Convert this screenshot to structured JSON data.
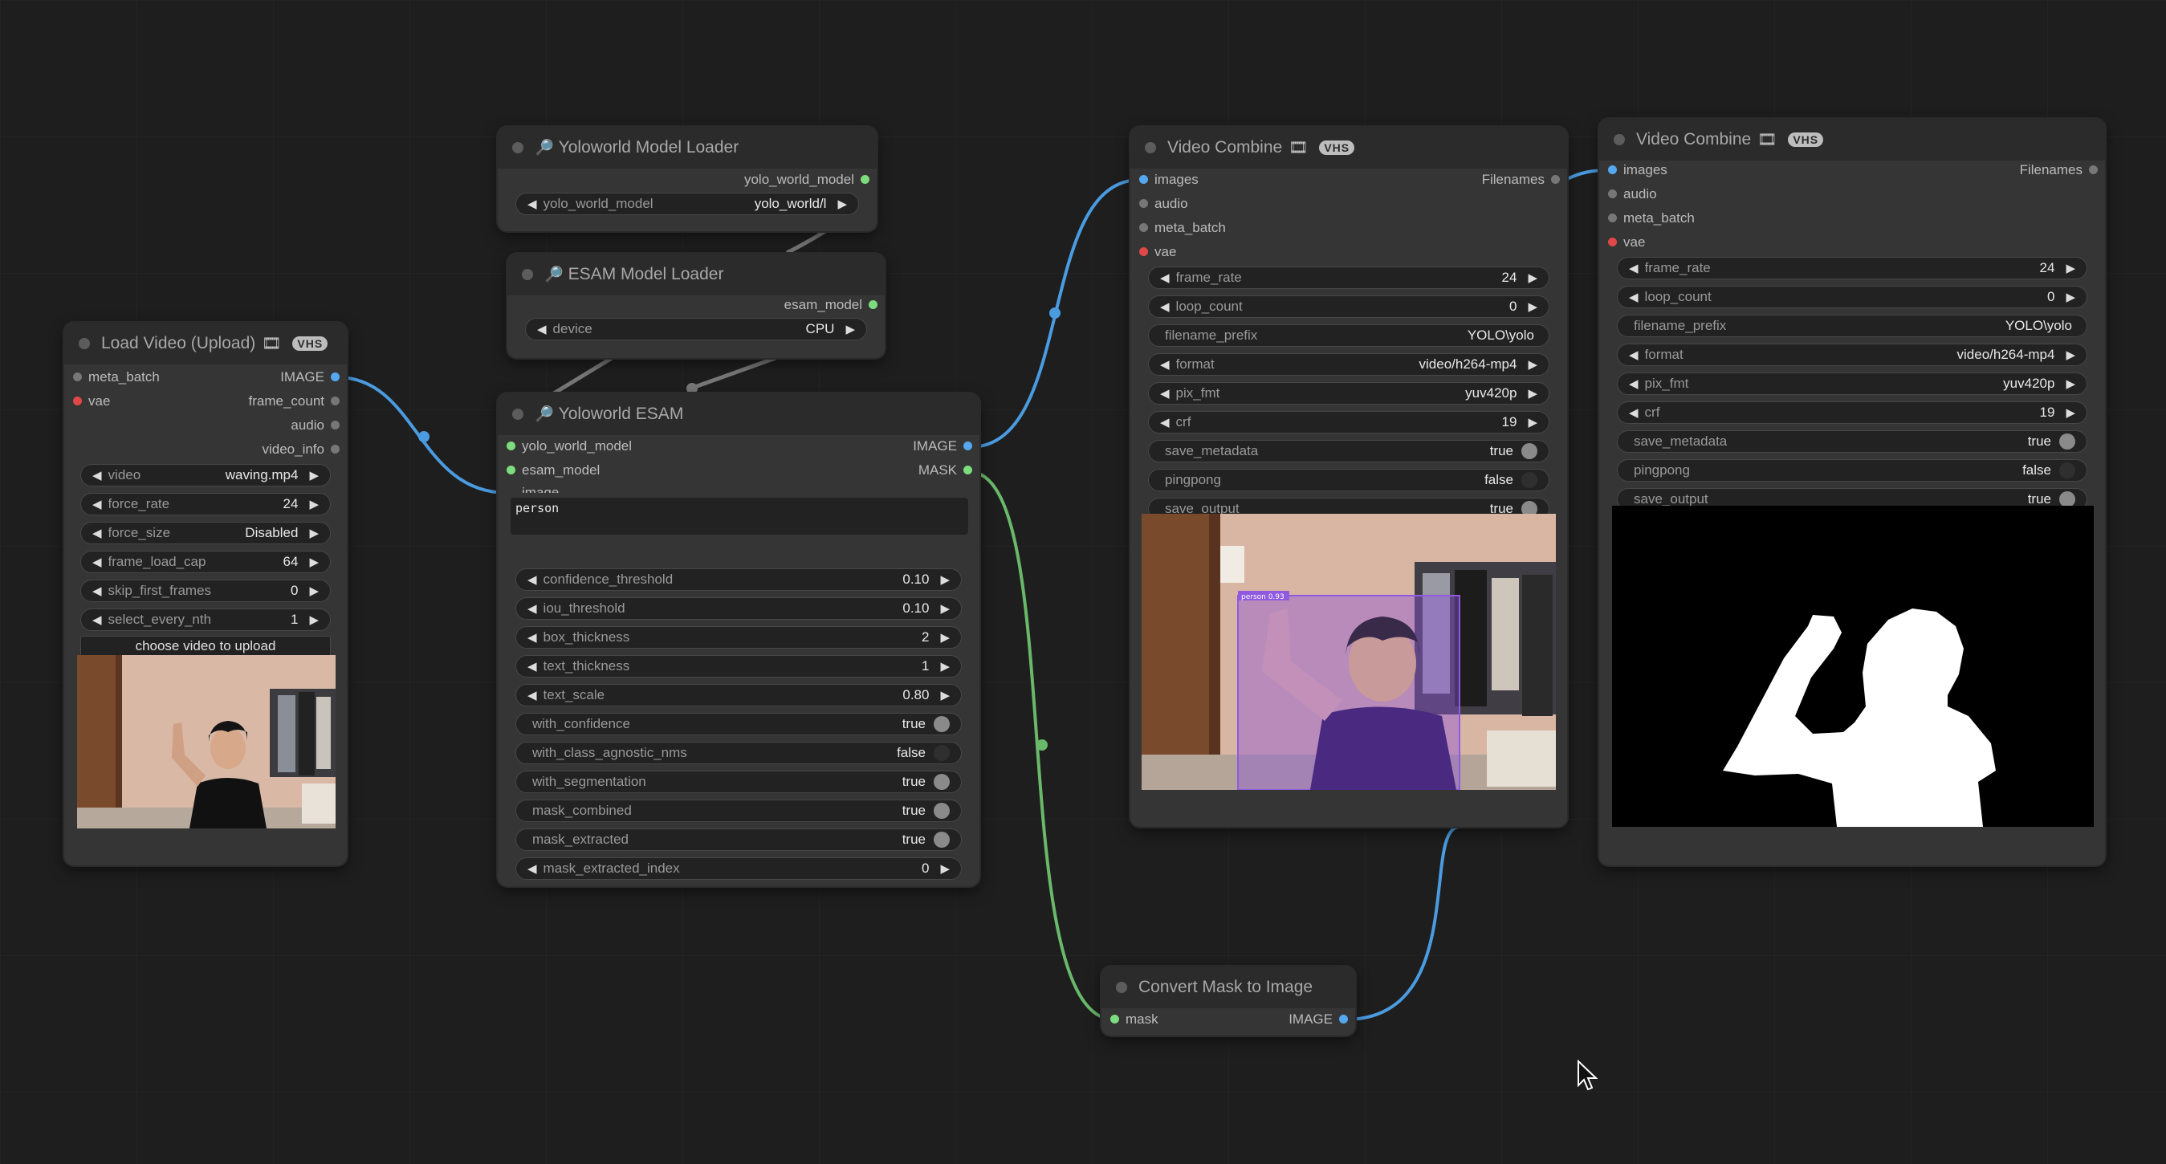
{
  "nodes": {
    "yolo_loader": {
      "title": "Yoloworld Model Loader",
      "output": "yolo_world_model",
      "widget": {
        "label": "yolo_world_model",
        "value": "yolo_world/l"
      }
    },
    "esam_loader": {
      "title": "ESAM Model Loader",
      "output": "esam_model",
      "widget": {
        "label": "device",
        "value": "CPU"
      }
    },
    "load_video": {
      "title": "Load Video (Upload)",
      "badge": "VHS",
      "inputs": [
        "meta_batch",
        "vae"
      ],
      "outputs": [
        "IMAGE",
        "frame_count",
        "audio",
        "video_info"
      ],
      "widgets": [
        {
          "label": "video",
          "value": "waving.mp4"
        },
        {
          "label": "force_rate",
          "value": "24"
        },
        {
          "label": "force_size",
          "value": "Disabled"
        },
        {
          "label": "frame_load_cap",
          "value": "64"
        },
        {
          "label": "skip_first_frames",
          "value": "0"
        },
        {
          "label": "select_every_nth",
          "value": "1"
        }
      ],
      "upload_label": "choose video to upload"
    },
    "esam": {
      "title": "Yoloworld ESAM",
      "inputs": [
        "yolo_world_model",
        "esam_model",
        "image"
      ],
      "outputs": [
        "IMAGE",
        "MASK"
      ],
      "categories": "person",
      "widgets": [
        {
          "label": "confidence_threshold",
          "value": "0.10",
          "kind": "num"
        },
        {
          "label": "iou_threshold",
          "value": "0.10",
          "kind": "num"
        },
        {
          "label": "box_thickness",
          "value": "2",
          "kind": "num"
        },
        {
          "label": "text_thickness",
          "value": "1",
          "kind": "num"
        },
        {
          "label": "text_scale",
          "value": "0.80",
          "kind": "num"
        },
        {
          "label": "with_confidence",
          "value": "true",
          "kind": "toggle"
        },
        {
          "label": "with_class_agnostic_nms",
          "value": "false",
          "kind": "toggle"
        },
        {
          "label": "with_segmentation",
          "value": "true",
          "kind": "toggle"
        },
        {
          "label": "mask_combined",
          "value": "true",
          "kind": "toggle"
        },
        {
          "label": "mask_extracted",
          "value": "true",
          "kind": "toggle"
        },
        {
          "label": "mask_extracted_index",
          "value": "0",
          "kind": "num"
        }
      ]
    },
    "combine1": {
      "title": "Video Combine",
      "badge": "VHS",
      "inputs": [
        "images",
        "audio",
        "meta_batch",
        "vae"
      ],
      "output": "Filenames",
      "widgets": [
        {
          "label": "frame_rate",
          "value": "24",
          "kind": "num"
        },
        {
          "label": "loop_count",
          "value": "0",
          "kind": "num"
        },
        {
          "label": "filename_prefix",
          "value": "YOLO\\yolo",
          "kind": "text"
        },
        {
          "label": "format",
          "value": "video/h264-mp4",
          "kind": "num"
        },
        {
          "label": "pix_fmt",
          "value": "yuv420p",
          "kind": "num"
        },
        {
          "label": "crf",
          "value": "19",
          "kind": "num"
        },
        {
          "label": "save_metadata",
          "value": "true",
          "kind": "toggle"
        },
        {
          "label": "pingpong",
          "value": "false",
          "kind": "toggle"
        },
        {
          "label": "save_output",
          "value": "true",
          "kind": "toggle"
        }
      ],
      "detection_label": "person 0.93"
    },
    "combine2": {
      "title": "Video Combine",
      "badge": "VHS",
      "inputs": [
        "images",
        "audio",
        "meta_batch",
        "vae"
      ],
      "output": "Filenames",
      "widgets": [
        {
          "label": "frame_rate",
          "value": "24",
          "kind": "num"
        },
        {
          "label": "loop_count",
          "value": "0",
          "kind": "num"
        },
        {
          "label": "filename_prefix",
          "value": "YOLO\\yolo",
          "kind": "text"
        },
        {
          "label": "format",
          "value": "video/h264-mp4",
          "kind": "num"
        },
        {
          "label": "pix_fmt",
          "value": "yuv420p",
          "kind": "num"
        },
        {
          "label": "crf",
          "value": "19",
          "kind": "num"
        },
        {
          "label": "save_metadata",
          "value": "true",
          "kind": "toggle"
        },
        {
          "label": "pingpong",
          "value": "false",
          "kind": "toggle"
        },
        {
          "label": "save_output",
          "value": "true",
          "kind": "toggle"
        }
      ]
    },
    "mask_to_image": {
      "title": "Convert Mask to Image",
      "input": "mask",
      "output": "IMAGE"
    }
  },
  "icons": {
    "node_icon": "magnifier-icon",
    "badge_icon": "film-icon"
  },
  "colors": {
    "image_link": "#4a9be0",
    "mask_link": "#6ab86a",
    "model_slot": "#7ddc7d",
    "vae_slot": "#e04848",
    "image_slot": "#55a8f0",
    "inactive_slot": "#777777"
  }
}
